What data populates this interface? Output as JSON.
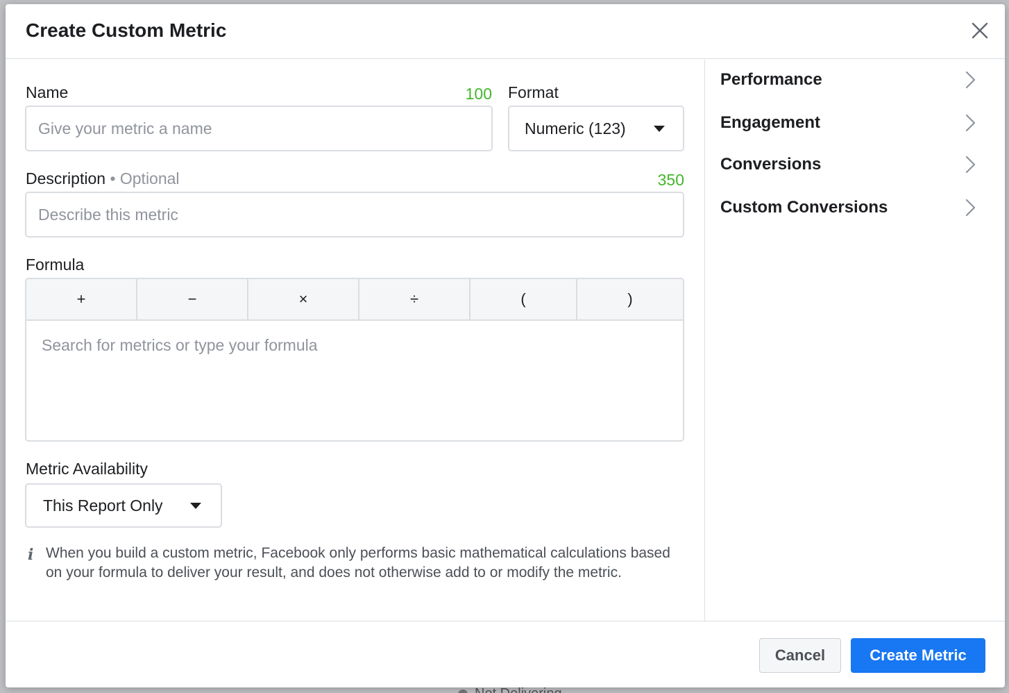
{
  "backdrop": {
    "peek_text": "Not Delivering"
  },
  "dialog": {
    "title": "Create Custom Metric"
  },
  "name_field": {
    "label": "Name",
    "counter": "100",
    "placeholder": "Give your metric a name",
    "value": ""
  },
  "format_field": {
    "label": "Format",
    "selected": "Numeric (123)"
  },
  "description_field": {
    "label": "Description",
    "optional": "• Optional",
    "counter": "350",
    "placeholder": "Describe this metric",
    "value": ""
  },
  "formula": {
    "label": "Formula",
    "operators": [
      {
        "label": "+",
        "name": "plus"
      },
      {
        "label": "−",
        "name": "minus"
      },
      {
        "label": "×",
        "name": "multiply"
      },
      {
        "label": "÷",
        "name": "divide"
      },
      {
        "label": "(",
        "name": "open-paren"
      },
      {
        "label": ")",
        "name": "close-paren"
      }
    ],
    "placeholder": "Search for metrics or type your formula",
    "value": ""
  },
  "availability": {
    "label": "Metric Availability",
    "selected": "This Report Only"
  },
  "info": {
    "icon": "info-icon",
    "text": "When you build a custom metric, Facebook only performs basic mathematical calculations based on your formula to deliver your result, and does not otherwise add to or modify the metric."
  },
  "categories": [
    {
      "label": "Performance",
      "icon": "chevron-right-icon"
    },
    {
      "label": "Engagement",
      "icon": "chevron-right-icon"
    },
    {
      "label": "Conversions",
      "icon": "chevron-right-icon"
    },
    {
      "label": "Custom Conversions",
      "icon": "chevron-right-icon"
    }
  ],
  "footer": {
    "cancel_label": "Cancel",
    "create_label": "Create Metric"
  },
  "colors": {
    "primary": "#1877f2",
    "counter": "#42b72a",
    "border": "#dadde1",
    "text": "#1c1e21",
    "muted": "#90949c"
  }
}
